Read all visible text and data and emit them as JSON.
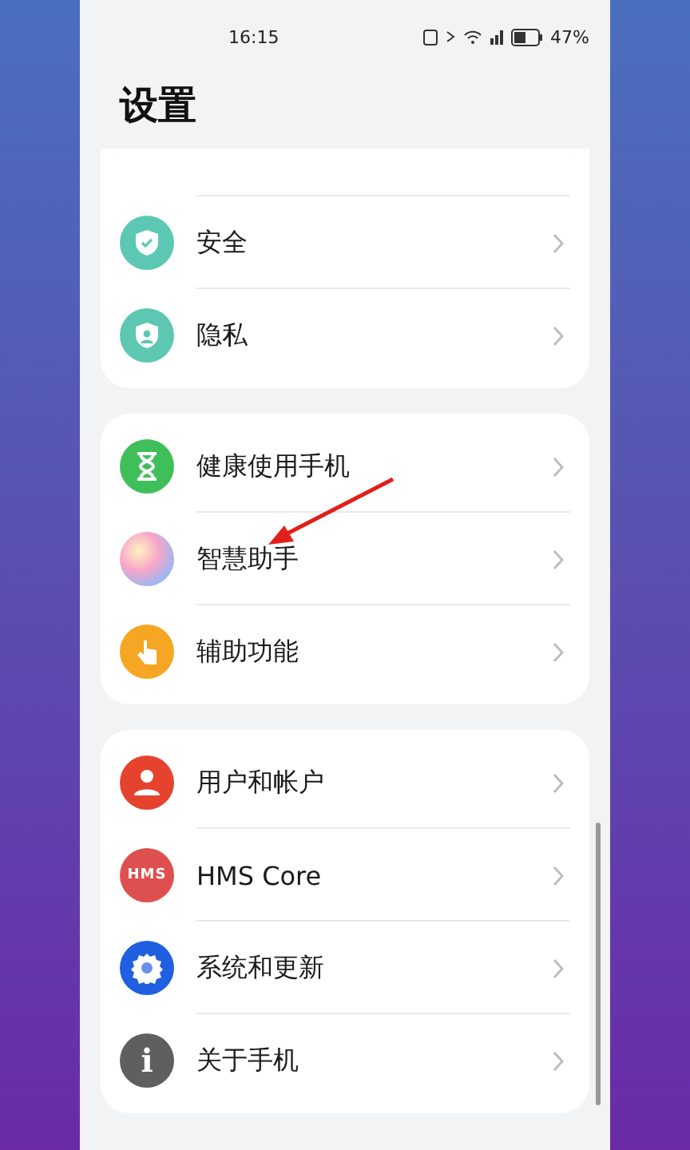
{
  "status_bar": {
    "time": "16:15",
    "battery": "47%"
  },
  "title": "设置",
  "groups": [
    {
      "items": [
        {
          "label": "安全",
          "kind": "shield"
        },
        {
          "label": "隐私",
          "kind": "privacy"
        }
      ]
    },
    {
      "items": [
        {
          "label": "健康使用手机",
          "kind": "hourglass"
        },
        {
          "label": "智慧助手",
          "kind": "orb"
        },
        {
          "label": "辅助功能",
          "kind": "hand"
        }
      ]
    },
    {
      "items": [
        {
          "label": "用户和帐户",
          "kind": "user"
        },
        {
          "label": "HMS Core",
          "kind": "hms",
          "icon_text": "HMS"
        },
        {
          "label": "系统和更新",
          "kind": "gear"
        },
        {
          "label": "关于手机",
          "kind": "info",
          "icon_text": "i"
        }
      ]
    }
  ]
}
